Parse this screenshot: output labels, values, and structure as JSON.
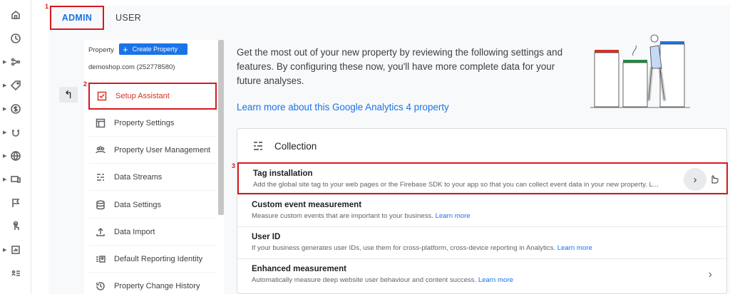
{
  "markers": {
    "one": "1",
    "two": "2",
    "three": "3"
  },
  "tabs": {
    "admin": "ADMIN",
    "user": "USER"
  },
  "rail": {
    "icons": [
      "home-icon",
      "clock-icon",
      "share-icon",
      "tag-icon",
      "dollar-icon",
      "magnet-icon",
      "globe-icon",
      "devices-icon",
      "flag-icon",
      "touch-icon",
      "reports-icon",
      "list-icon"
    ]
  },
  "property": {
    "label": "Property",
    "create_button": "Create Property",
    "id_text": "demoshop.com (252778580)"
  },
  "nav": {
    "items": [
      {
        "label": "Setup Assistant",
        "icon": "checklist-icon"
      },
      {
        "label": "Property Settings",
        "icon": "layout-icon"
      },
      {
        "label": "Property User Management",
        "icon": "people-icon"
      },
      {
        "label": "Data Streams",
        "icon": "streams-icon"
      },
      {
        "label": "Data Settings",
        "icon": "database-icon"
      },
      {
        "label": "Data Import",
        "icon": "upload-icon"
      },
      {
        "label": "Default Reporting Identity",
        "icon": "identity-icon"
      },
      {
        "label": "Property Change History",
        "icon": "history-icon"
      }
    ]
  },
  "main": {
    "intro": "Get the most out of your new property by reviewing the following settings and features. By configuring these now, you'll have more complete data for your future analyses.",
    "learn_more": "Learn more about this Google Analytics 4 property"
  },
  "card": {
    "title": "Collection",
    "rows": [
      {
        "title": "Tag installation",
        "desc": "Add the global site tag to your web pages or the Firebase SDK to your app so that you can collect event data in your new property. L...",
        "link": ""
      },
      {
        "title": "Custom event measurement",
        "desc": "Measure custom events that are important to your business.",
        "link": "Learn more"
      },
      {
        "title": "User ID",
        "desc": "If your business generates user IDs, use them for cross-platform, cross-device reporting in Analytics.",
        "link": "Learn more"
      },
      {
        "title": "Enhanced measurement",
        "desc": "Automatically measure deep website user behaviour and content success.",
        "link": "Learn more"
      }
    ]
  },
  "colors": {
    "accent": "#1a73e8",
    "highlight": "#d71920"
  }
}
